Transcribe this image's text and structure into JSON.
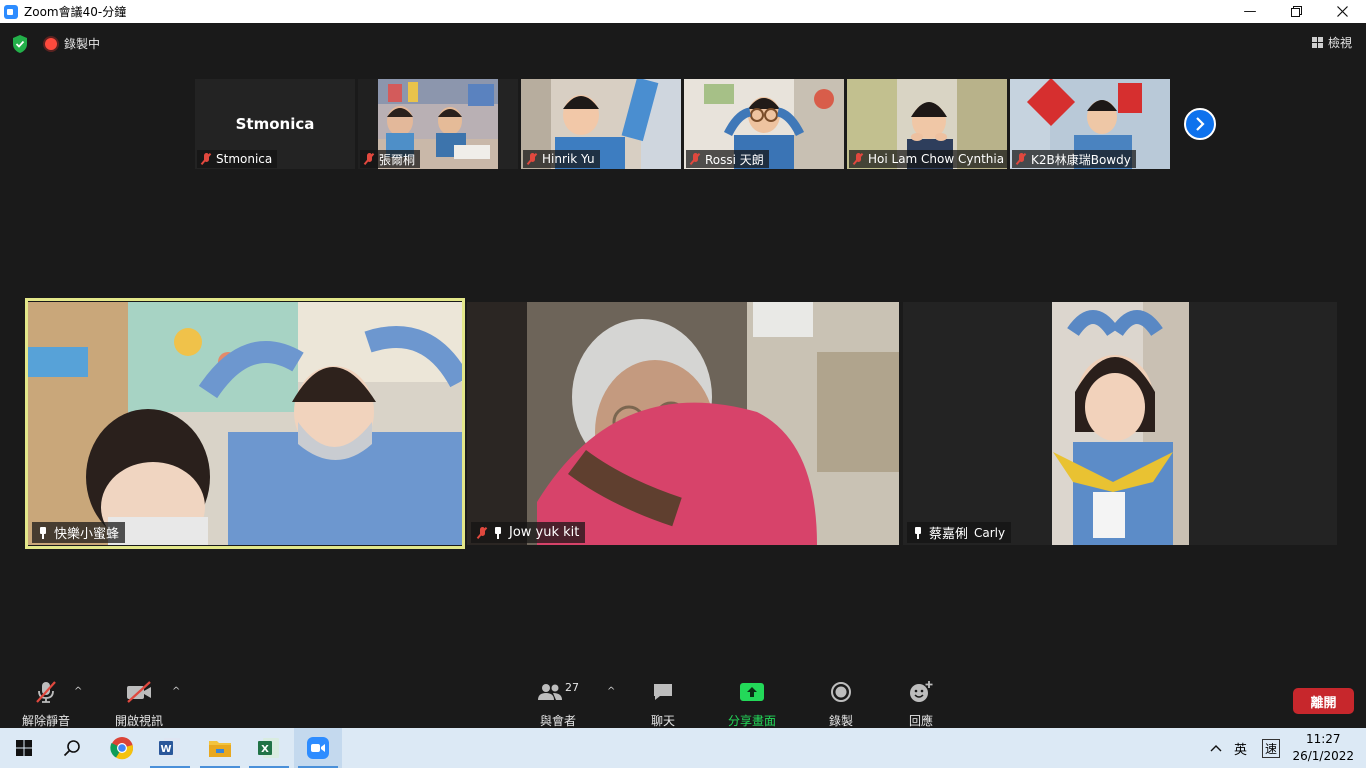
{
  "window": {
    "title": "Zoom會議40-分鐘"
  },
  "topbar": {
    "recording_label": "錄製中",
    "view_label": "檢視"
  },
  "thumbnails": [
    {
      "name": "Stmonica",
      "display": "Stmonica",
      "muted": true,
      "video": false
    },
    {
      "name": "張爾桐",
      "muted": true,
      "video": true
    },
    {
      "name": "Hinrik Yu",
      "muted": true,
      "video": true
    },
    {
      "name": "Rossi 天朗",
      "muted": true,
      "video": true
    },
    {
      "name": "Hoi Lam  Chow Cynthia",
      "muted": true,
      "video": true
    },
    {
      "name": "K2B林康瑞Bowdy",
      "muted": true,
      "video": true
    }
  ],
  "main_tiles": [
    {
      "name": "快樂小蜜蜂",
      "speaking": true,
      "muted": false
    },
    {
      "name": "Jow yuk kit",
      "speaking": false,
      "muted": true
    },
    {
      "name": "蔡嘉俐",
      "name_suffix": "Carly",
      "speaking": false,
      "muted": false
    }
  ],
  "toolbar": {
    "unmute_label": "解除靜音",
    "start_video_label": "開啟視訊",
    "participants_label": "與會者",
    "participants_count": "27",
    "chat_label": "聊天",
    "share_label": "分享畫面",
    "record_label": "錄製",
    "reactions_label": "回應",
    "leave_label": "離開"
  },
  "taskbar": {
    "ime_lang": "英",
    "ime_mode": "速",
    "time": "11:27",
    "date": "26/1/2022"
  },
  "colors": {
    "share_green": "#23d959",
    "leave_red": "#c7272c",
    "speaker_border": "#e3e78a",
    "next_blue": "#0e72ed"
  }
}
